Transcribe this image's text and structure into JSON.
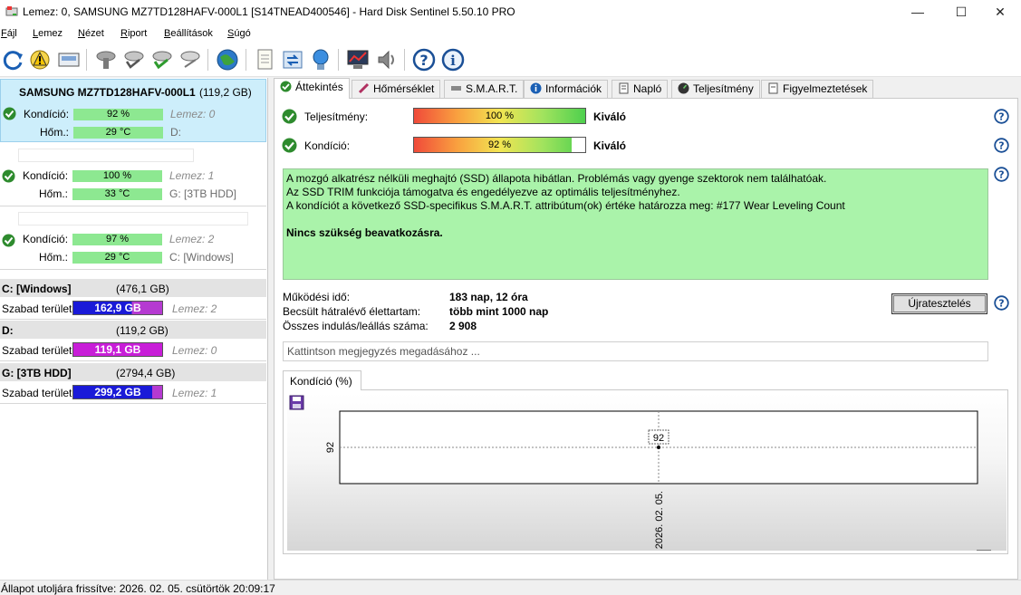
{
  "window": {
    "title": "Lemez: 0, SAMSUNG MZ7TD128HAFV-000L1 [S14TNEAD400546]  -  Hard Disk Sentinel 5.50.10 PRO",
    "minimize": "—",
    "maximize": "☐",
    "close": "✕"
  },
  "menu": [
    {
      "pre": "",
      "u": "F",
      "post": "ájl"
    },
    {
      "pre": "",
      "u": "L",
      "post": "emez"
    },
    {
      "pre": "",
      "u": "N",
      "post": "ézet"
    },
    {
      "pre": "",
      "u": "R",
      "post": "iport"
    },
    {
      "pre": "",
      "u": "B",
      "post": "eállítások"
    },
    {
      "pre": "",
      "u": "S",
      "post": "úgó"
    }
  ],
  "toolbar": {
    "icons": [
      "refresh-icon",
      "alert-icon",
      "disk-drive-icon",
      "disk-tool-icon",
      "disk-verify-icon",
      "disk-check-icon",
      "disk-repair-icon",
      "globe-icon",
      "report-icon",
      "transfer-icon",
      "network-icon",
      "monitor-icon",
      "speaker-icon",
      "help-icon",
      "info-icon"
    ]
  },
  "disks": [
    {
      "title": "SAMSUNG MZ7TD128HAFV-000L1",
      "size": "(119,2 GB)",
      "health_label": "Kondíció:",
      "health_value": "92 %",
      "temp_label": "Hőm.:",
      "temp_value": "29 °C",
      "disk_index": "Lemez: 0",
      "drives": "D:"
    },
    {
      "title": "",
      "size": "",
      "health_label": "Kondíció:",
      "health_value": "100 %",
      "temp_label": "Hőm.:",
      "temp_value": "33 °C",
      "disk_index": "Lemez: 1",
      "drives": "G: [3TB HDD]"
    },
    {
      "title": "",
      "size": "",
      "health_label": "Kondíció:",
      "health_value": "97 %",
      "temp_label": "Hőm.:",
      "temp_value": "29 °C",
      "disk_index": "Lemez: 2",
      "drives": "C: [Windows]"
    }
  ],
  "volumes": [
    {
      "name": "C: [Windows]",
      "size": "(476,1 GB)",
      "free_label": "Szabad terület",
      "free": "162,9 GB",
      "disk": "Lemez: 2",
      "used_fraction": 0.66,
      "bar_color": "#1a1ad8"
    },
    {
      "name": "D:",
      "size": "(119,2 GB)",
      "free_label": "Szabad terület",
      "free": "119,1 GB",
      "disk": "Lemez: 0",
      "used_fraction": 0.0,
      "bar_color": "#c81ed8"
    },
    {
      "name": "G: [3TB HDD]",
      "size": "(2794,4 GB)",
      "free_label": "Szabad terület",
      "free": "299,2 GB",
      "disk": "Lemez: 1",
      "used_fraction": 0.89,
      "bar_color": "#1a1ad8"
    }
  ],
  "tabs": [
    {
      "label": "Áttekintés",
      "icon": "check-icon"
    },
    {
      "label": "Hőmérséklet",
      "icon": "thermometer-icon"
    },
    {
      "label": "S.M.A.R.T.",
      "icon": "smart-icon"
    },
    {
      "label": "Információk",
      "icon": "info-icon"
    },
    {
      "label": "Napló",
      "icon": "log-icon"
    },
    {
      "label": "Teljesítmény",
      "icon": "performance-icon"
    },
    {
      "label": "Figyelmeztetések",
      "icon": "warnings-icon"
    }
  ],
  "overview": {
    "performance_label": "Teljesítmény:",
    "performance_value": "100 %",
    "performance_fraction": 1.0,
    "performance_rating": "Kiváló",
    "health_label": "Kondíció:",
    "health_value": "92 %",
    "health_fraction": 0.92,
    "health_rating": "Kiváló",
    "info_line1": "A mozgó alkatrész nélküli meghajtó (SSD) állapota hibátlan. Problémás vagy gyenge szektorok nem találhatóak.",
    "info_line2": "Az SSD TRIM funkciója támogatva és engedélyezve az optimális teljesítményhez.",
    "info_line3": "A kondíciót a következő SSD-specifikus S.M.A.R.T. attribútum(ok) értéke határozza meg:  #177 Wear Leveling Count",
    "info_line4": "Nincs szükség beavatkozásra.",
    "uptime_label": "Működési idő:",
    "uptime_value": "183 nap, 12 óra",
    "lifetime_label": "Becsült hátralévő élettartam:",
    "lifetime_value": "több mint 1000 nap",
    "startstop_label": "Összes indulás/leállás száma:",
    "startstop_value": "2 908",
    "retest_button": "Újratesztelés",
    "note_placeholder": "Kattintson megjegyzés megadásához ..."
  },
  "chart_tab": "Kondíció  (%)",
  "chart_data": {
    "type": "line",
    "x": [
      "2026. 02. 05."
    ],
    "series": [
      {
        "values": [
          92
        ]
      }
    ],
    "y_tick_labels": [
      "92"
    ],
    "data_labels": [
      "92"
    ],
    "grid": true,
    "colors": {
      "line": "#000000",
      "grid": "#888888"
    }
  },
  "status": "Állapot utoljára frissítve: 2026. 02. 05. csütörtök 20:09:17",
  "colors": {
    "selected_disk": "#cdeefb",
    "health_bar": "#8de891",
    "info_box": "#aaf3aa",
    "check_green": "#2e8b2e"
  }
}
